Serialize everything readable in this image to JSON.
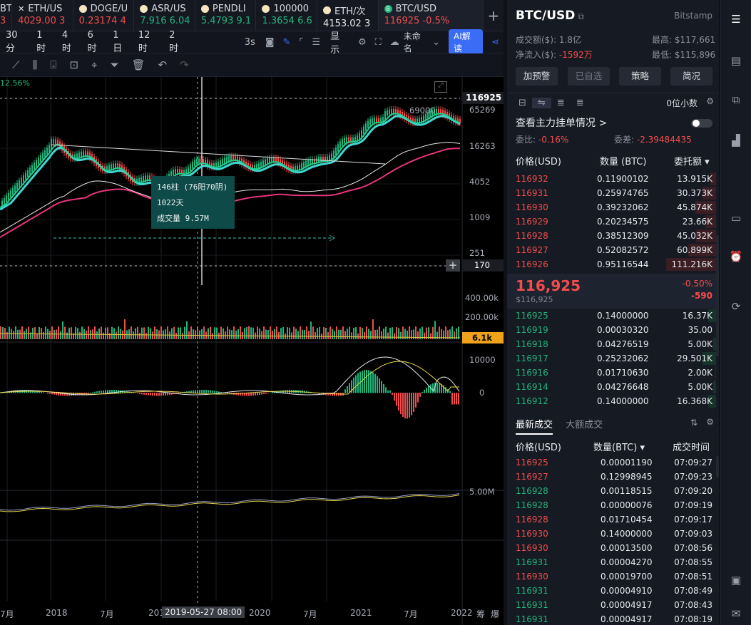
{
  "tabs": [
    {
      "name": "BT",
      "value": "3",
      "dir": "down",
      "icon": "cut-tab"
    },
    {
      "name": "ETH/US",
      "value": "4029.00 3",
      "dir": "down",
      "icon": "x-icon"
    },
    {
      "name": "DOGE/U",
      "value": "0.23174 4",
      "dir": "down",
      "icon": "coin-icon"
    },
    {
      "name": "ASR/US",
      "value": "7.916 6.04",
      "dir": "up",
      "icon": "coin-icon"
    },
    {
      "name": "PENDLI",
      "value": "5.4793 9.1",
      "dir": "up",
      "icon": "coin-icon"
    },
    {
      "name": "100000",
      "value": "1.3654 6.6",
      "dir": "up",
      "icon": "coin-icon"
    },
    {
      "name": "ETH/次",
      "value": "4153.02 3",
      "dir": "neutral",
      "icon": "coin-icon"
    },
    {
      "name": "BTC/USD",
      "value": "116925",
      "change": "-0.5%",
      "dir": "down",
      "icon": "bitcoin-icon",
      "active": true
    }
  ],
  "toolbar": {
    "timeframes": [
      "30分",
      "1时",
      "4时",
      "6时",
      "1日",
      "12时",
      "2时"
    ],
    "refresh": "3s",
    "display": "显示",
    "layout_name": "未命名",
    "ai_label": "AI解读"
  },
  "chart": {
    "pct_label": "12.56%",
    "price_tag": "116925",
    "cross_price": "170",
    "vol_tag": "6.1k",
    "peak_label": "69000",
    "price_axis": [
      "65269",
      "16263",
      "4052",
      "1009",
      "251"
    ],
    "vol_axis": [
      "400.00k",
      "200.00k"
    ],
    "macd_axis": [
      "10000",
      "0"
    ],
    "bottom_axis": [
      "5.00M"
    ],
    "tooltip": {
      "bars": "146柱 (76阳70阴)",
      "days": "1022天",
      "volume": "成交量 9.57M"
    },
    "x_labels": [
      "7月",
      "2018",
      "7月",
      "201",
      "2020",
      "7月",
      "2021",
      "7月",
      "2022",
      "筹",
      "爆"
    ],
    "crosshair_date": "2019-05-27 08:00",
    "colors": {
      "up": "#21b57c",
      "down": "#f24d4d",
      "ma_green": "#1fcf8a",
      "ma_cyan": "#3fd7d0",
      "ma_pink": "#e6357d",
      "ma_white": "#e8e8e8"
    }
  },
  "panel": {
    "symbol": "BTC/USD",
    "exchange": "Bitstamp",
    "turnover_label": "成交额($):",
    "turnover": "1.8亿",
    "inflow_label": "净流入($):",
    "inflow": "-1592万",
    "high_label": "最高:",
    "high": "$117,661",
    "low_label": "最低:",
    "low": "$115,896",
    "buttons": [
      "加预警",
      "已自选",
      "策略",
      "简况"
    ],
    "precision": "0位小数",
    "main_order": "查看主力挂单情况 >",
    "weibi_label": "委比:",
    "weibi": "-0.16%",
    "weicha_label": "委差:",
    "weicha": "-2.39484435",
    "ob_headers": [
      "价格(USD)",
      "数量 (BTC)",
      "委托额"
    ],
    "asks": [
      {
        "price": "116932",
        "qty": "0.11900102",
        "total": "13.915K",
        "depth": 0.12
      },
      {
        "price": "116931",
        "qty": "0.25974765",
        "total": "30.373K",
        "depth": 0.27
      },
      {
        "price": "116930",
        "qty": "0.39232062",
        "total": "45.874K",
        "depth": 0.41
      },
      {
        "price": "116929",
        "qty": "0.20234575",
        "total": "23.66K",
        "depth": 0.21
      },
      {
        "price": "116928",
        "qty": "0.38512309",
        "total": "45.032K",
        "depth": 0.4
      },
      {
        "price": "116927",
        "qty": "0.52082572",
        "total": "60.899K",
        "depth": 0.55
      },
      {
        "price": "116926",
        "qty": "0.95116544",
        "total": "111.216K",
        "depth": 1.0
      }
    ],
    "last_price": "116,925",
    "last_price_usd": "$116,925",
    "change_pct": "-0.50%",
    "change_abs": "-590",
    "bids": [
      {
        "price": "116925",
        "qty": "0.14000000",
        "total": "16.37K",
        "depth": 0.15
      },
      {
        "price": "116919",
        "qty": "0.00030320",
        "total": "35.00",
        "depth": 0.0
      },
      {
        "price": "116918",
        "qty": "0.04276519",
        "total": "5.00K",
        "depth": 0.05
      },
      {
        "price": "116917",
        "qty": "0.25232062",
        "total": "29.501K",
        "depth": 0.27
      },
      {
        "price": "116916",
        "qty": "0.01710630",
        "total": "2.00K",
        "depth": 0.02
      },
      {
        "price": "116914",
        "qty": "0.04276648",
        "total": "5.00K",
        "depth": 0.05
      },
      {
        "price": "116912",
        "qty": "0.14000000",
        "total": "16.368K",
        "depth": 0.15
      }
    ],
    "trade_tabs": [
      "最新成交",
      "大额成交"
    ],
    "trade_headers": [
      "价格(USD)",
      "数量(BTC)",
      "成交时间"
    ],
    "trades": [
      {
        "price": "116925",
        "qty": "0.00001190",
        "time": "07:09:27",
        "dir": "down"
      },
      {
        "price": "116927",
        "qty": "0.12998945",
        "time": "07:09:23",
        "dir": "down"
      },
      {
        "price": "116928",
        "qty": "0.00118515",
        "time": "07:09:20",
        "dir": "up"
      },
      {
        "price": "116928",
        "qty": "0.00000076",
        "time": "07:09:19",
        "dir": "up"
      },
      {
        "price": "116928",
        "qty": "0.01710454",
        "time": "07:09:17",
        "dir": "down"
      },
      {
        "price": "116930",
        "qty": "0.14000000",
        "time": "07:09:03",
        "dir": "down"
      },
      {
        "price": "116930",
        "qty": "0.00013500",
        "time": "07:08:56",
        "dir": "down"
      },
      {
        "price": "116931",
        "qty": "0.00004270",
        "time": "07:08:55",
        "dir": "up"
      },
      {
        "price": "116930",
        "qty": "0.00019700",
        "time": "07:08:51",
        "dir": "down"
      },
      {
        "price": "116931",
        "qty": "0.00004910",
        "time": "07:08:49",
        "dir": "up"
      },
      {
        "price": "116931",
        "qty": "0.00004917",
        "time": "07:08:43",
        "dir": "up"
      },
      {
        "price": "116931",
        "qty": "0.00004917",
        "time": "07:08:19",
        "dir": "up"
      }
    ]
  },
  "sidebar": [
    "orderbook-icon",
    "document-icon",
    "copy-icon",
    "chart-bars-icon",
    "eth-card-icon",
    "alarm-icon",
    "swap-icon",
    "layout-icon",
    "comment-icon"
  ]
}
